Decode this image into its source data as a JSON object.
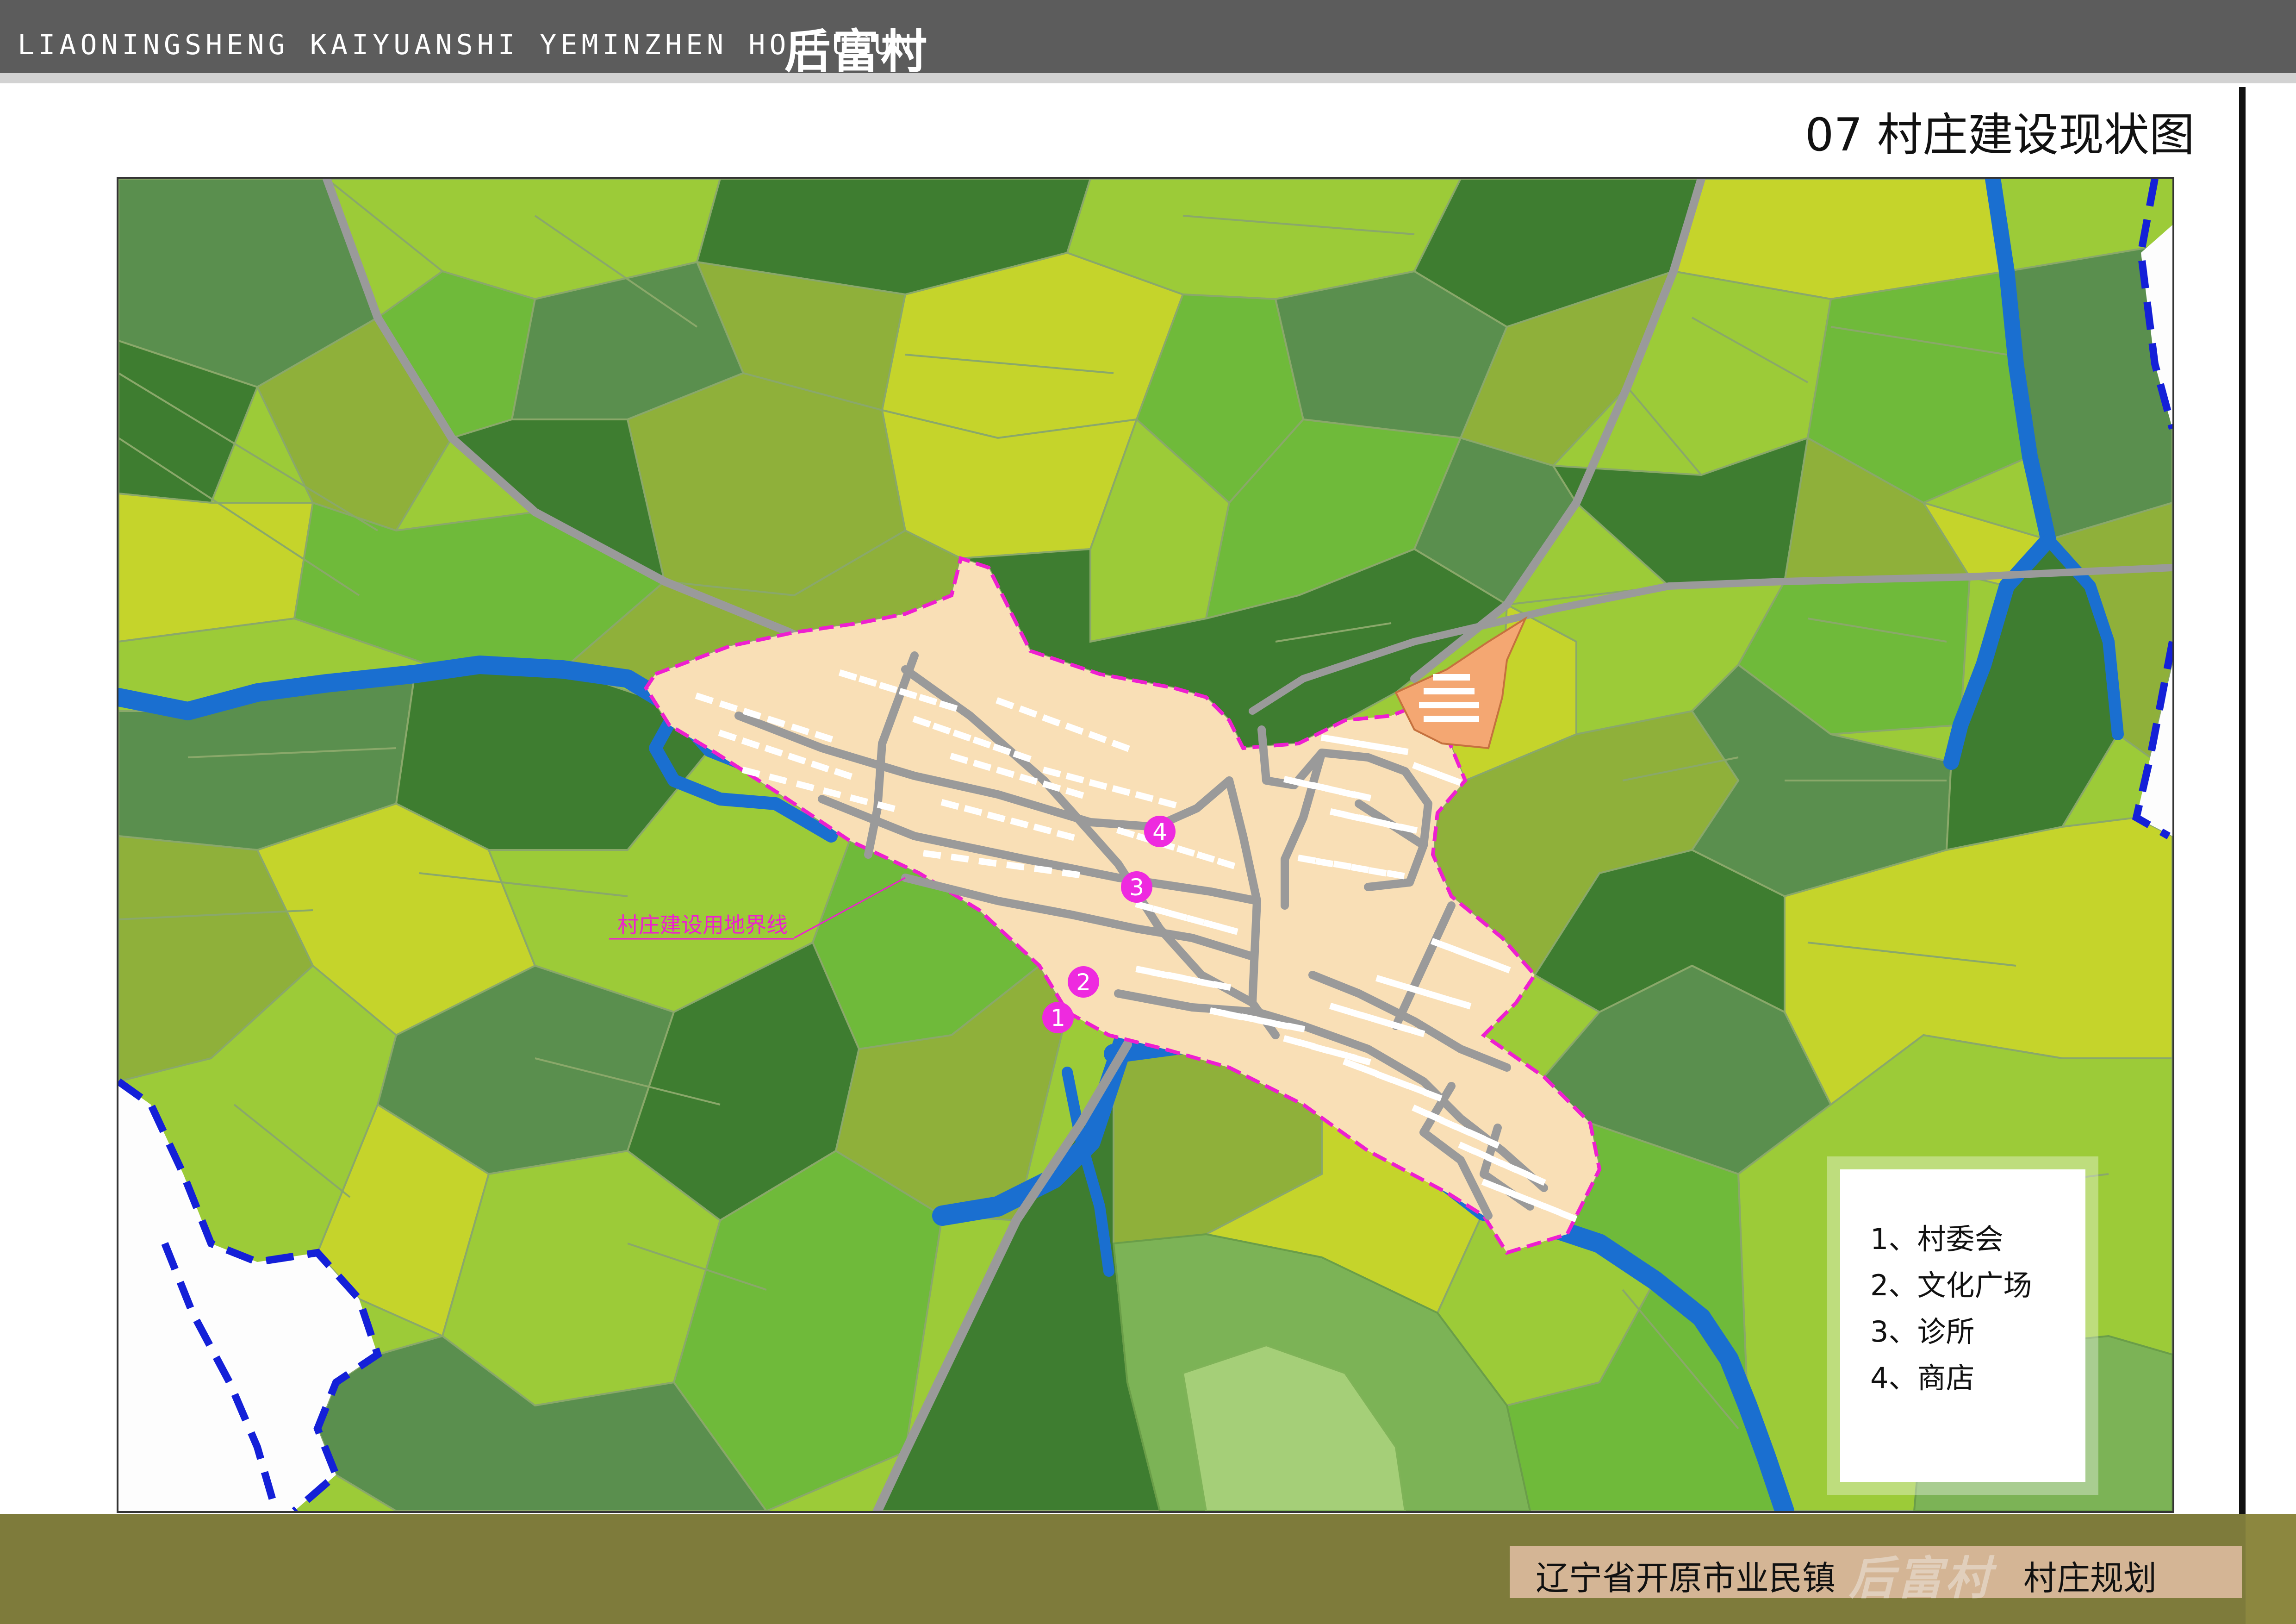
{
  "header": {
    "latin_title": "LIAONINGSHENG KAIYUANSHI YEMINZHEN HOUFUCUN",
    "village_name": "后富村"
  },
  "plate": {
    "title": "07 村庄建设现状图"
  },
  "map": {
    "boundary_label": "村庄建设用地界线",
    "markers": [
      "1",
      "2",
      "3",
      "4"
    ],
    "colors": {
      "field_palette": [
        "#c5d42b",
        "#9ccb38",
        "#6fba3a",
        "#5a8f4e",
        "#3e7d30",
        "#8fb03a"
      ],
      "village_fill": "#f9dfb6",
      "village_boundary": "#ee1fd0",
      "road": "#9a9a9a",
      "river": "#1a6fd0",
      "county_line": "#1420d8",
      "factory": "#f4a772",
      "marker": "#ee2adf"
    }
  },
  "legend": {
    "items": [
      "1、村委会",
      "2、文化广场",
      "3、诊所",
      "4、商店"
    ]
  },
  "footer": {
    "location": "辽宁省开原市业民镇",
    "village": "后富村",
    "plan": "村庄规划"
  }
}
